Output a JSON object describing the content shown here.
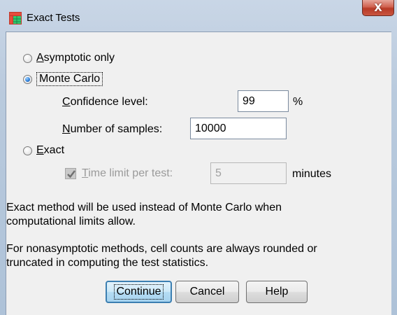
{
  "window": {
    "title": "Exact Tests",
    "close_glyph": "X",
    "icon": "spss-table-icon"
  },
  "options": {
    "asymptotic": {
      "pre": "",
      "mnemonic": "A",
      "post": "symptotic only",
      "selected": false
    },
    "monte_carlo": {
      "label": "Monte Carlo",
      "selected": true
    },
    "exact": {
      "mnemonic": "E",
      "post": "xact",
      "selected": false
    }
  },
  "monte_carlo": {
    "confidence": {
      "mnemonic": "C",
      "post": "onfidence level:",
      "value": "99",
      "unit": "%"
    },
    "samples": {
      "mnemonic": "N",
      "post": "umber of samples:",
      "value": "10000"
    }
  },
  "exact": {
    "time_limit": {
      "mnemonic": "T",
      "post": "ime limit per test:",
      "checked": true,
      "value": "5",
      "unit": "minutes"
    }
  },
  "notes": {
    "line1a": "Exact method will be used instead of Monte Carlo when",
    "line1b": "computational limits allow.",
    "line2a": "For nonasymptotic methods, cell counts are always rounded or",
    "line2b": "truncated in computing the test statistics."
  },
  "buttons": {
    "continue": "Continue",
    "cancel": "Cancel",
    "help": "Help"
  }
}
